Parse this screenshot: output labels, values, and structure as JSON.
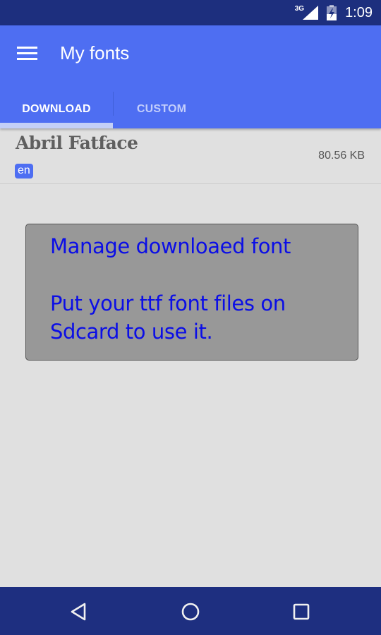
{
  "status_bar": {
    "network_type": "3G",
    "time": "1:09",
    "icons": [
      "signal-icon",
      "battery-charging-icon"
    ]
  },
  "app_bar": {
    "menu_icon": "hamburger-menu-icon",
    "title": "My fonts"
  },
  "tabs": [
    {
      "label": "DOWNLOAD",
      "active": true
    },
    {
      "label": "CUSTOM",
      "active": false
    }
  ],
  "font_list": [
    {
      "name": "Abril Fatface",
      "language": "en",
      "size": "80.56 KB"
    }
  ],
  "info_box": {
    "title": "Manage downloaed font",
    "message_line1": "Put your ttf font files on",
    "message_line2": "Sdcard to use it."
  },
  "nav_bar": {
    "icons": [
      "back-icon",
      "home-icon",
      "recents-icon"
    ]
  },
  "colors": {
    "primary": "#4e6ef2",
    "primary_dark": "#1d2f7e",
    "info_text": "#0b0ee6",
    "background": "#e0e0e0"
  }
}
